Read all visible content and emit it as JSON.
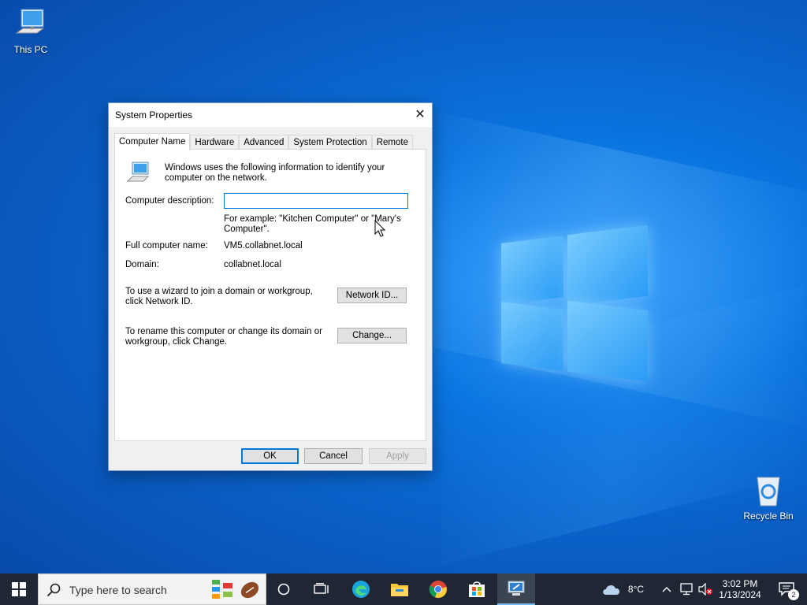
{
  "desktop": {
    "icons": [
      {
        "label": "This PC",
        "icon": "computer-icon"
      },
      {
        "label": "Recycle Bin",
        "icon": "recycle-bin-icon"
      }
    ]
  },
  "dialog": {
    "title": "System Properties",
    "close_symbol": "✕",
    "tabs": [
      {
        "label": "Computer Name",
        "active": true
      },
      {
        "label": "Hardware",
        "active": false
      },
      {
        "label": "Advanced",
        "active": false
      },
      {
        "label": "System Protection",
        "active": false
      },
      {
        "label": "Remote",
        "active": false
      }
    ],
    "intro_text": "Windows uses the following information to identify your computer on the network.",
    "description_label": "Computer description:",
    "description_value": "",
    "example_text": "For example: \"Kitchen Computer\" or \"Mary's Computer\".",
    "full_name_label": "Full computer name:",
    "full_name_value": "VM5.collabnet.local",
    "domain_label": "Domain:",
    "domain_value": "collabnet.local",
    "wizard_text": "To use a wizard to join a domain or workgroup, click Network ID.",
    "network_id_button": "Network ID...",
    "rename_text": "To rename this computer or change its domain or workgroup, click Change.",
    "change_button": "Change...",
    "ok_button": "OK",
    "cancel_button": "Cancel",
    "apply_button": "Apply"
  },
  "taskbar": {
    "search_placeholder": "Type here to search",
    "pinned": [
      "task-view-icon",
      "edge-icon",
      "file-explorer-icon",
      "chrome-icon",
      "store-icon",
      "system-properties-icon"
    ],
    "weather": "8°C",
    "time": "3:02 PM",
    "date": "1/13/2024",
    "notification_count": "2"
  },
  "colors": {
    "accent": "#0078d7",
    "taskbar_bg": "#1f2735",
    "desktop_bg": "#0a64d0"
  }
}
